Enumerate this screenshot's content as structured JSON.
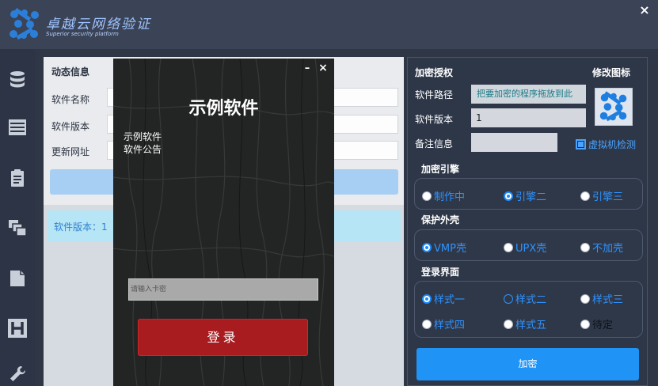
{
  "app": {
    "brand_cn": "卓越云网络验证",
    "brand_en": "Superior security platform"
  },
  "sidebar": {
    "icons": [
      "database-icon",
      "list-icon",
      "clipboard-icon",
      "layers-icon",
      "documents-icon",
      "h-icon",
      "wrench-icon"
    ]
  },
  "left_panel": {
    "title": "动态信息",
    "fields": [
      {
        "label": "软件名称",
        "value": ""
      },
      {
        "label": "软件版本",
        "value": ""
      },
      {
        "label": "更新网址",
        "value": ""
      }
    ],
    "strip_text": "软件版本：1"
  },
  "dialog": {
    "title": "示例软件",
    "line1": "示例软件",
    "line2": "软件公告",
    "card_placeholder": "请输入卡密",
    "login_label": "登录",
    "minimize": "–",
    "close": "×"
  },
  "right_panel": {
    "title": "加密授权",
    "icon_title": "修改图标",
    "path_label": "软件路径",
    "path_value": "把要加密的程序拖放到此",
    "version_label": "软件版本",
    "version_value": "1",
    "note_label": "备注信息",
    "note_value": "",
    "vm_label": "虚拟机检测",
    "vm_checked": true,
    "engine_title": "加密引擎",
    "engine_options": [
      {
        "label": "制作中",
        "selected": false
      },
      {
        "label": "引擎二",
        "selected": true
      },
      {
        "label": "引擎三",
        "selected": false
      }
    ],
    "shell_title": "保护外壳",
    "shell_options": [
      {
        "label": "VMP壳",
        "selected": true
      },
      {
        "label": "UPX壳",
        "selected": false
      },
      {
        "label": "不加壳",
        "selected": false
      }
    ],
    "login_title": "登录界面",
    "login_options": [
      {
        "label": "样式一",
        "selected": true
      },
      {
        "label": "样式二",
        "selected": false
      },
      {
        "label": "样式三",
        "selected": false
      },
      {
        "label": "样式四",
        "selected": false
      },
      {
        "label": "样式五",
        "selected": false
      },
      {
        "label": "待定",
        "selected": false
      }
    ],
    "encrypt_label": "加密"
  },
  "window": {
    "close": "×"
  },
  "colors": {
    "accent": "#1f93f6",
    "login_button": "#a81b1f",
    "radio_text": "#2f93ff"
  }
}
